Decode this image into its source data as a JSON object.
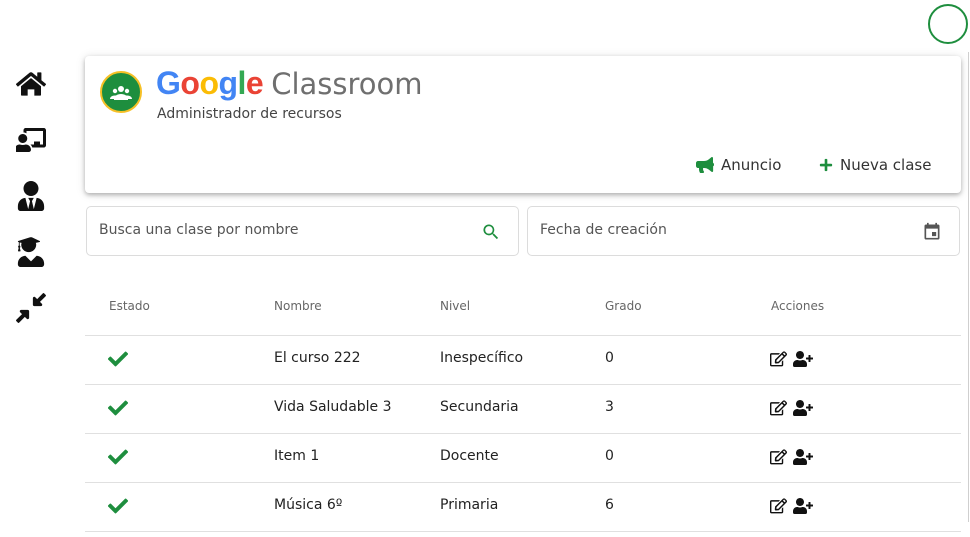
{
  "header": {
    "brand_google": [
      "G",
      "o",
      "o",
      "g",
      "l",
      "e"
    ],
    "brand_product": "Classroom",
    "subtitle": "Administrador de recursos",
    "announce_label": "Anuncio",
    "new_class_label": "Nueva clase"
  },
  "sidebar": {
    "items": [
      {
        "icon": "home-icon"
      },
      {
        "icon": "teacher-board-icon"
      },
      {
        "icon": "user-tie-icon"
      },
      {
        "icon": "graduate-icon"
      },
      {
        "icon": "compress-icon"
      }
    ]
  },
  "filters": {
    "search_placeholder": "Busca una clase por nombre",
    "date_placeholder": "Fecha de creación"
  },
  "table": {
    "columns": [
      "Estado",
      "Nombre",
      "Nivel",
      "Grado",
      "Acciones"
    ],
    "rows": [
      {
        "status": "active",
        "name": "El curso 222",
        "level": "Inespecífico",
        "grade": "0"
      },
      {
        "status": "active",
        "name": "Vida Saludable 3",
        "level": "Secundaria",
        "grade": "3"
      },
      {
        "status": "active",
        "name": "Item 1",
        "level": "Docente",
        "grade": "0"
      },
      {
        "status": "active",
        "name": "Música 6º",
        "level": "Primaria",
        "grade": "6"
      }
    ]
  },
  "colors": {
    "accent_green": "#1e8e3e",
    "google": [
      "#4285F4",
      "#EA4335",
      "#FBBC05",
      "#4285F4",
      "#34A853",
      "#EA4335"
    ]
  }
}
